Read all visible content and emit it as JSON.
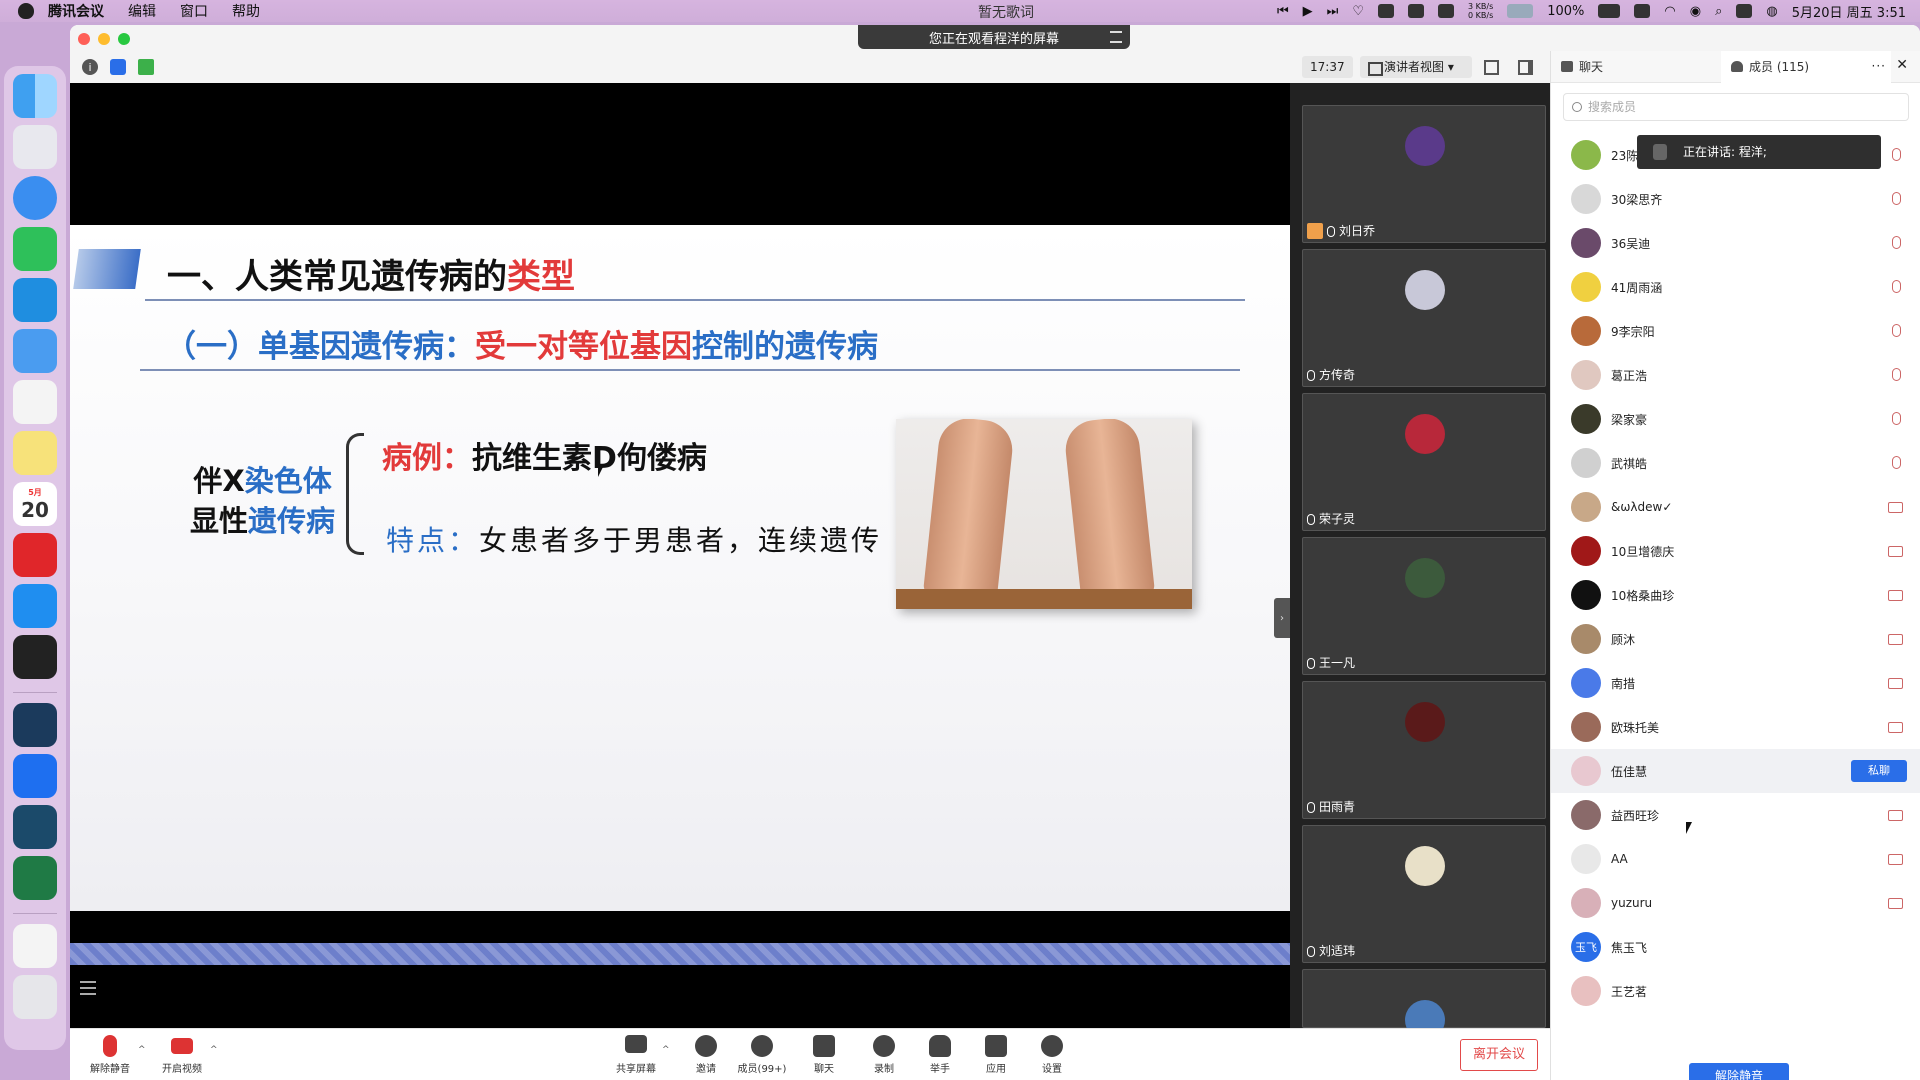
{
  "menubar": {
    "app_name": "腾讯会议",
    "items": [
      "编辑",
      "窗口",
      "帮助"
    ],
    "now_playing": "暂无歌词",
    "net_up": "3 KB/s",
    "net_down": "0 KB/s",
    "battery": "100%",
    "datetime": "5月20日 周五 3:51"
  },
  "dock": {
    "calendar_month": "5月",
    "calendar_day": "20"
  },
  "banner": {
    "text": "您正在观看程洋的屏幕"
  },
  "toolbar": {
    "timer": "17:37",
    "view_mode": "演讲者视图"
  },
  "slide": {
    "title_black": "一、人类常见遗传病的",
    "title_red": "类型",
    "subtitle_blue1": "（一）单基因遗传病：",
    "subtitle_red": "受一对等位基因",
    "subtitle_blue2": "控制的遗传病",
    "left_line1_black": "伴X",
    "left_line1_blue": "染色体",
    "left_line2_black": "显性",
    "left_line2_blue": "遗传病",
    "case_label": "病例：",
    "case_text": "抗维生素D佝偻病",
    "feature_label": "特点：",
    "feature_text": "女患者多于男患者，连续遗传"
  },
  "thumbnails": [
    {
      "name": "刘日乔",
      "color": "#5a3a8a"
    },
    {
      "name": "方传奇",
      "color": "#c8c8d8"
    },
    {
      "name": "荣子灵",
      "color": "#b8283a"
    },
    {
      "name": "王一凡",
      "color": "#3c5a3c"
    },
    {
      "name": "田雨青",
      "color": "#5a1a1a"
    },
    {
      "name": "刘适玮",
      "color": "#e8e0c8"
    },
    {
      "name": "",
      "color": "#4a7ab8"
    }
  ],
  "bottombar": {
    "unmute": "解除静音",
    "video": "开启视频",
    "share": "共享屏幕",
    "invite": "邀请",
    "members": "成员(99+)",
    "chat": "聊天",
    "record": "录制",
    "raise_hand": "举手",
    "apps": "应用",
    "settings": "设置",
    "leave": "离开会议"
  },
  "panel": {
    "tab_chat": "聊天",
    "tab_members": "成员 (115)",
    "more": "···",
    "close": "✕",
    "search_placeholder": "搜索成员",
    "speaking": "正在讲话: 程洋;",
    "private_chat": "私聊",
    "unmute_all": "解除静音",
    "members": [
      {
        "name": "23陈",
        "color": "#8bb84a",
        "status": "mic"
      },
      {
        "name": "30梁思齐",
        "color": "#d8d8d8",
        "status": "mic"
      },
      {
        "name": "36吴迪",
        "color": "#6a4a6a",
        "status": "mic"
      },
      {
        "name": "41周雨涵",
        "color": "#f0d040",
        "status": "mic"
      },
      {
        "name": "9李宗阳",
        "color": "#b86a3a",
        "status": "mic"
      },
      {
        "name": "葛正浩",
        "color": "#e0c8c0",
        "status": "mic"
      },
      {
        "name": "梁家豪",
        "color": "#3a3a2a",
        "status": "mic"
      },
      {
        "name": "武祺皓",
        "color": "#d0d0d0",
        "status": "mic"
      },
      {
        "name": "&ωλdew✓",
        "color": "#c8a888",
        "status": "cam"
      },
      {
        "name": "10旦增德庆",
        "color": "#a01818",
        "status": "cam"
      },
      {
        "name": "10格桑曲珍",
        "color": "#111111",
        "status": "cam"
      },
      {
        "name": "顾沐",
        "color": "#a88a6a",
        "status": "cam"
      },
      {
        "name": "南措",
        "color": "#4a7ae8",
        "status": "cam"
      },
      {
        "name": "欧珠托美",
        "color": "#9a6a5a",
        "status": "cam"
      },
      {
        "name": "伍佳慧",
        "color": "#e8c8d0",
        "status": "pm"
      },
      {
        "name": "益西旺珍",
        "color": "#8a6a6a",
        "status": "cam"
      },
      {
        "name": "AA",
        "color": "#e8e8e8",
        "status": "cam"
      },
      {
        "name": "yuzuru",
        "color": "#d8b0b8",
        "status": "cam"
      },
      {
        "name": "焦玉飞",
        "color": "#2a6ee8",
        "status": "none",
        "initial": "玉飞"
      },
      {
        "name": "王艺茗",
        "color": "#e8c0c0",
        "status": "none"
      }
    ]
  }
}
